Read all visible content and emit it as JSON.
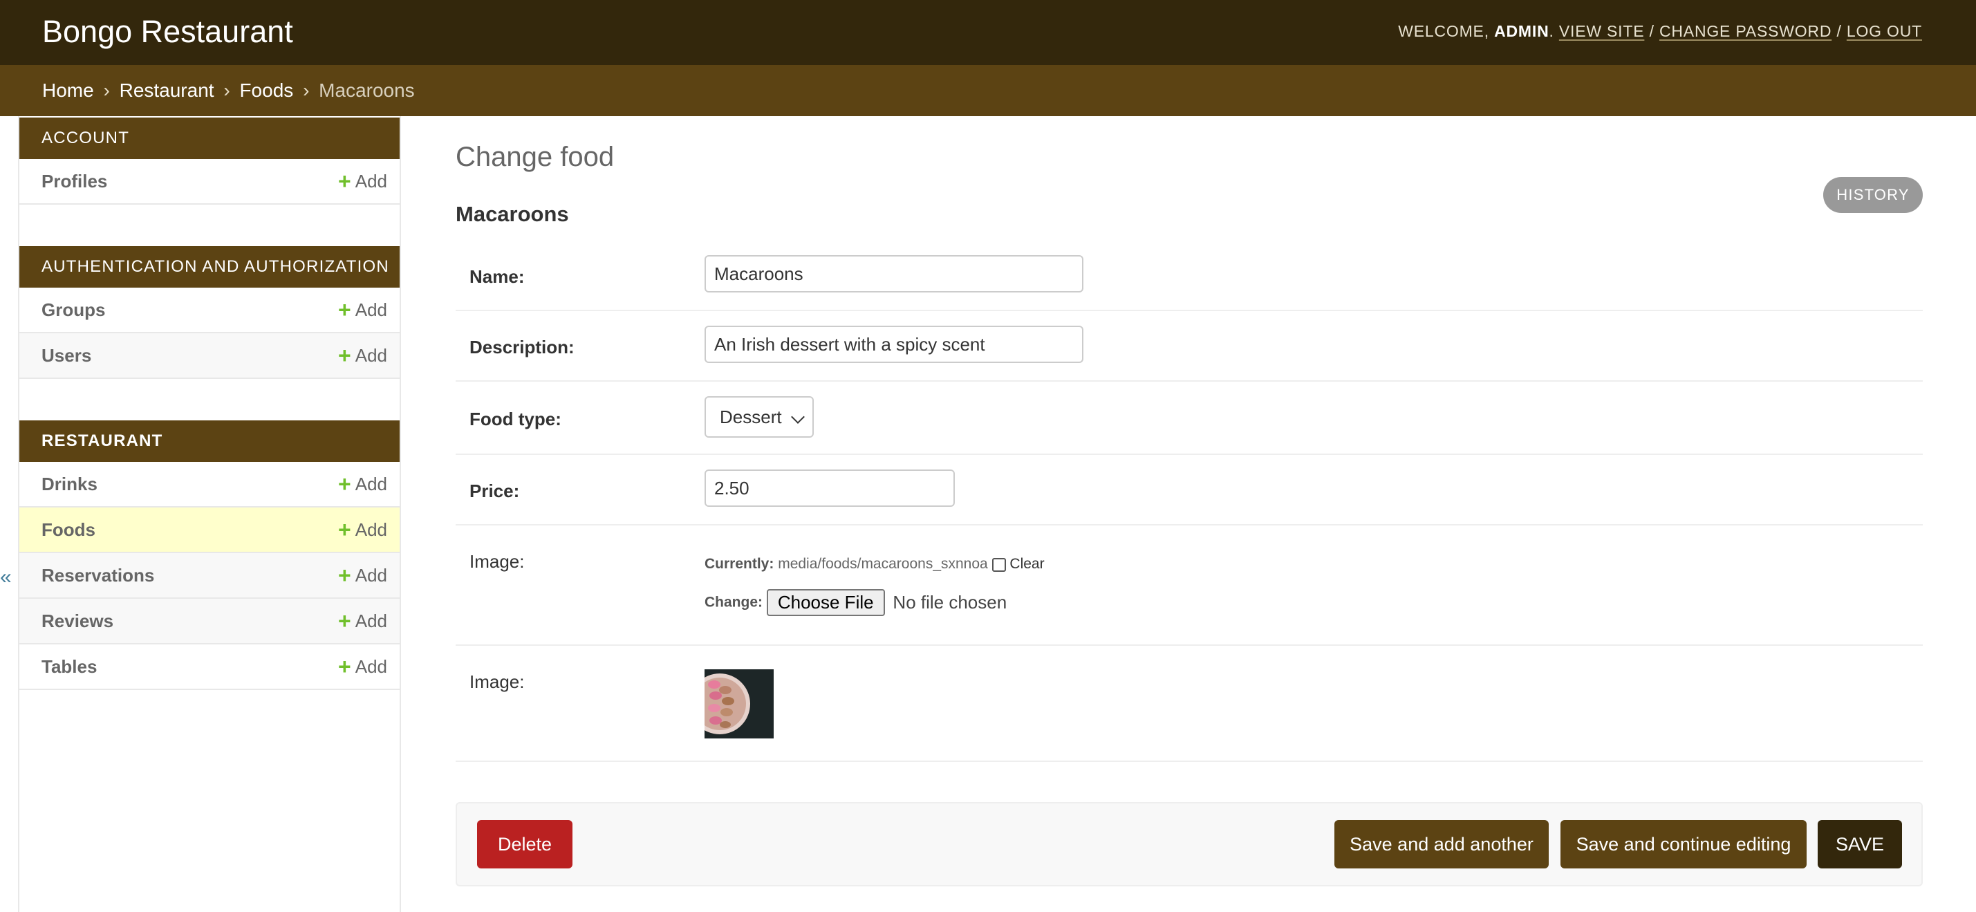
{
  "header": {
    "site_name": "Bongo Restaurant",
    "welcome": "WELCOME,",
    "username": "ADMIN",
    "view_site": "VIEW SITE",
    "change_password": "CHANGE PASSWORD",
    "log_out": "LOG OUT",
    "separator": "/"
  },
  "breadcrumbs": {
    "home": "Home",
    "app": "Restaurant",
    "model": "Foods",
    "current": "Macaroons",
    "separator": "›"
  },
  "sidebar": {
    "toggle": "«",
    "add_label": "Add",
    "modules": [
      {
        "caption": "Account",
        "models": [
          "Profiles"
        ]
      },
      {
        "caption": "Authentication and Authorization",
        "models": [
          "Groups",
          "Users"
        ]
      },
      {
        "caption": "Restaurant",
        "models": [
          "Drinks",
          "Foods",
          "Reservations",
          "Reviews",
          "Tables"
        ]
      }
    ],
    "selected_model": "Foods"
  },
  "content": {
    "title": "Change food",
    "history_button": "HISTORY",
    "object_title": "Macaroons",
    "fields": {
      "name": {
        "label": "Name:",
        "value": "Macaroons"
      },
      "description": {
        "label": "Description:",
        "value": "An Irish dessert with a spicy scent"
      },
      "food_type": {
        "label": "Food type:",
        "value": "Dessert"
      },
      "price": {
        "label": "Price:",
        "value": "2.50"
      },
      "image": {
        "label": "Image:",
        "currently_label": "Currently:",
        "currently_value": "media/foods/macaroons_sxnnoa",
        "clear_label": "Clear",
        "change_label": "Change:",
        "choose_file": "Choose File",
        "no_file": "No file chosen"
      },
      "image_preview": {
        "label": "Image:"
      }
    }
  },
  "submit_row": {
    "delete": "Delete",
    "save_add_another": "Save and add another",
    "save_continue": "Save and continue editing",
    "save": "SAVE"
  },
  "colors": {
    "header_bg": "#33270c",
    "breadcrumb_bg": "#5c4313",
    "selected_row_bg": "#ffffcc",
    "add_icon": "#70bf2b",
    "delete_bg": "#ba2121"
  }
}
